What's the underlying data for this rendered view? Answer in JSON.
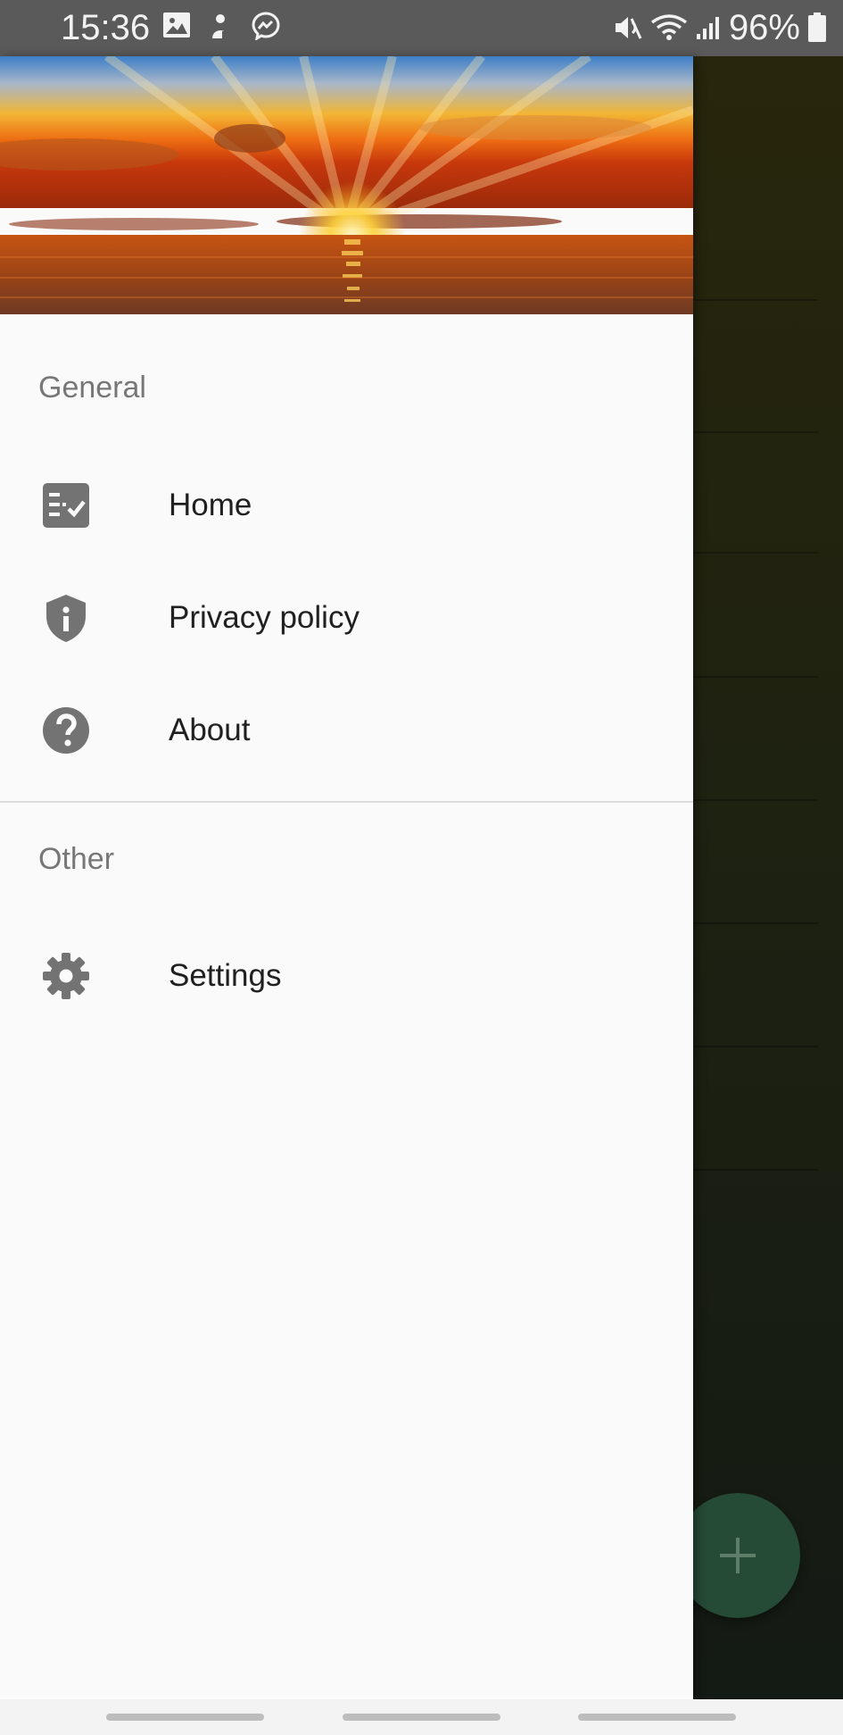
{
  "status_bar": {
    "time": "15:36",
    "left_icons": [
      "gallery-icon",
      "sticky-note-icon",
      "messenger-icon"
    ],
    "right_icons": [
      "mute-icon",
      "wifi-icon",
      "signal-icon",
      "battery-icon"
    ],
    "battery": "96%"
  },
  "drawer": {
    "header_image": "sunset-over-sea",
    "sections": [
      {
        "title": "General",
        "items": [
          {
            "label": "Home",
            "icon": "checklist-icon"
          },
          {
            "label": "Privacy policy",
            "icon": "shield-info-icon"
          },
          {
            "label": "About",
            "icon": "help-circle-icon"
          }
        ]
      },
      {
        "title": "Other",
        "items": [
          {
            "label": "Settings",
            "icon": "gear-icon"
          }
        ]
      }
    ]
  },
  "fab": {
    "icon": "plus-icon"
  },
  "colors": {
    "drawer_bg": "#fafafa",
    "icon_gray": "#737373",
    "section_gray": "#777777",
    "fab_green": "#254a35"
  }
}
